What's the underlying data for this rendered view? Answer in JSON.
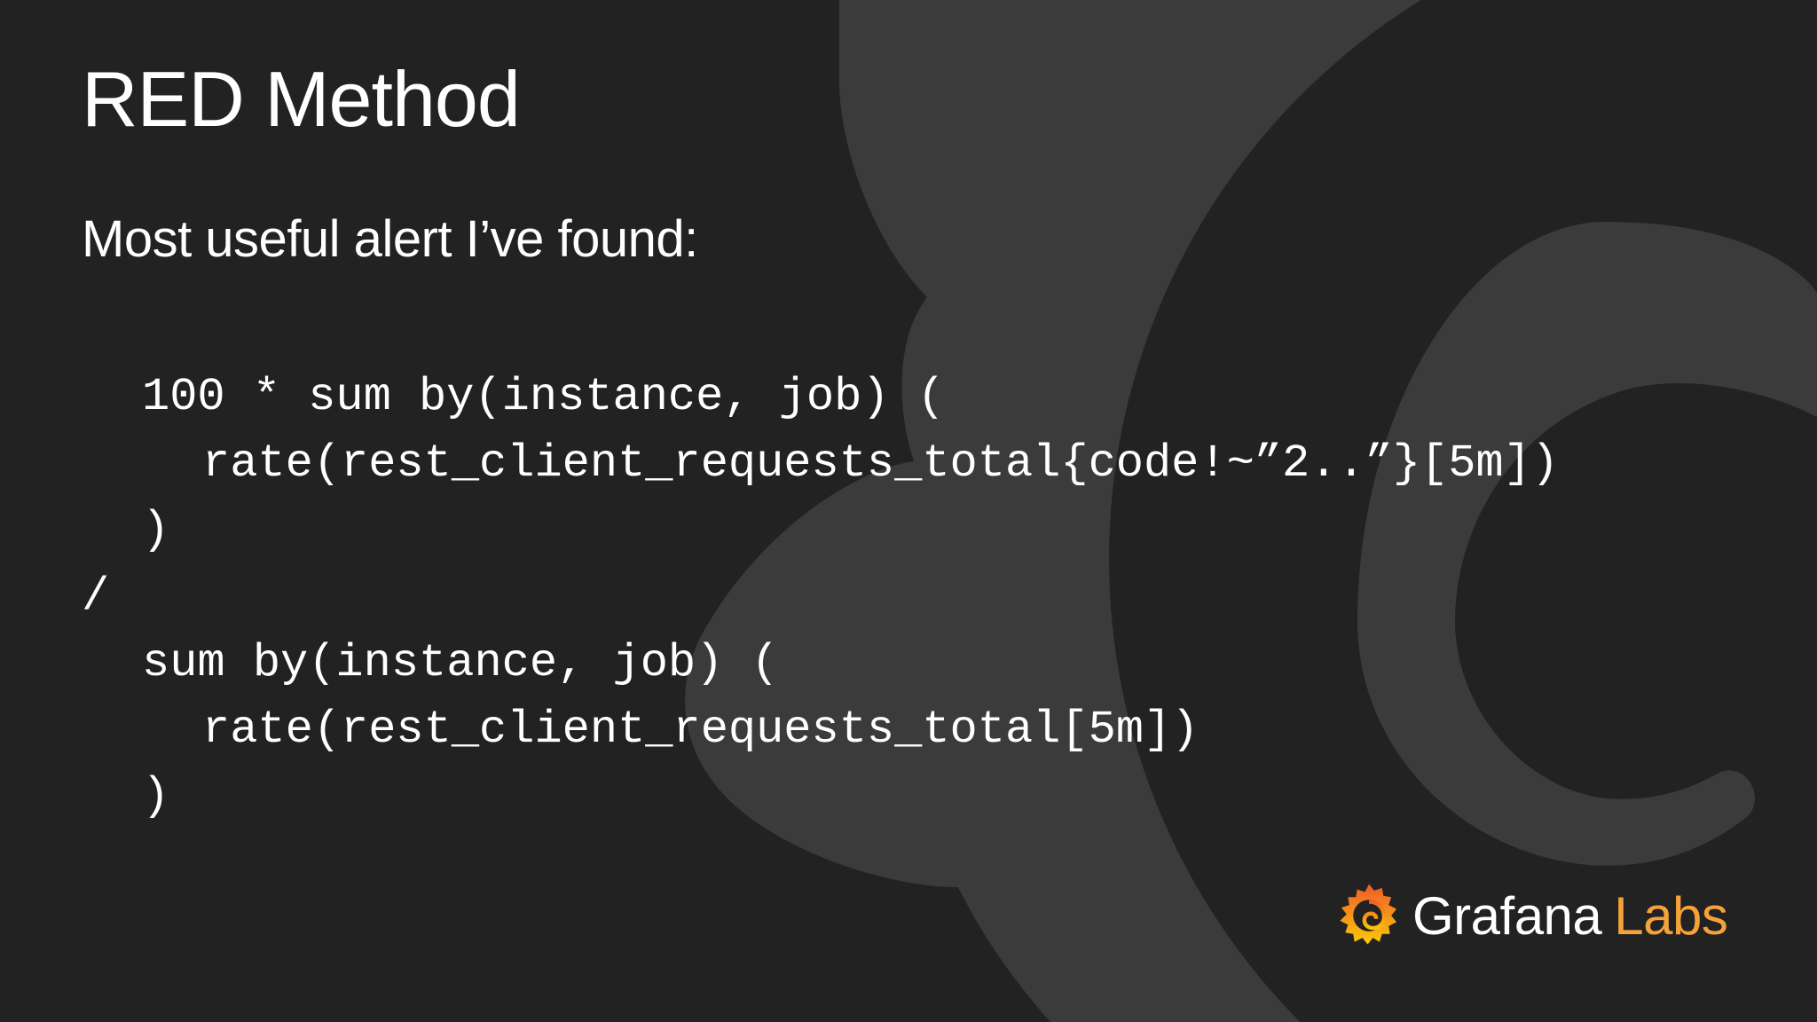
{
  "slide": {
    "title": "RED Method",
    "subtitle": "Most useful alert I’ve found:",
    "code_lines": [
      "100 * sum by(instance, job) (",
      "rate(rest_client_requests_total{code!~”2..”}[5m])",
      ")",
      "/",
      "sum by(instance, job) (",
      "rate(rest_client_requests_total[5m])",
      ")"
    ]
  },
  "logo": {
    "icon": "grafana-swirl-icon",
    "brand": "Grafana",
    "suffix": "Labs",
    "colors": {
      "brand": "#ffffff",
      "suffix": "#f6a23a",
      "icon_gradient_start": "#f05a28",
      "icon_gradient_end": "#fbca0a"
    }
  },
  "theme": {
    "background": "#222222",
    "watermark": "#3c3c3c",
    "text": "#ffffff"
  }
}
